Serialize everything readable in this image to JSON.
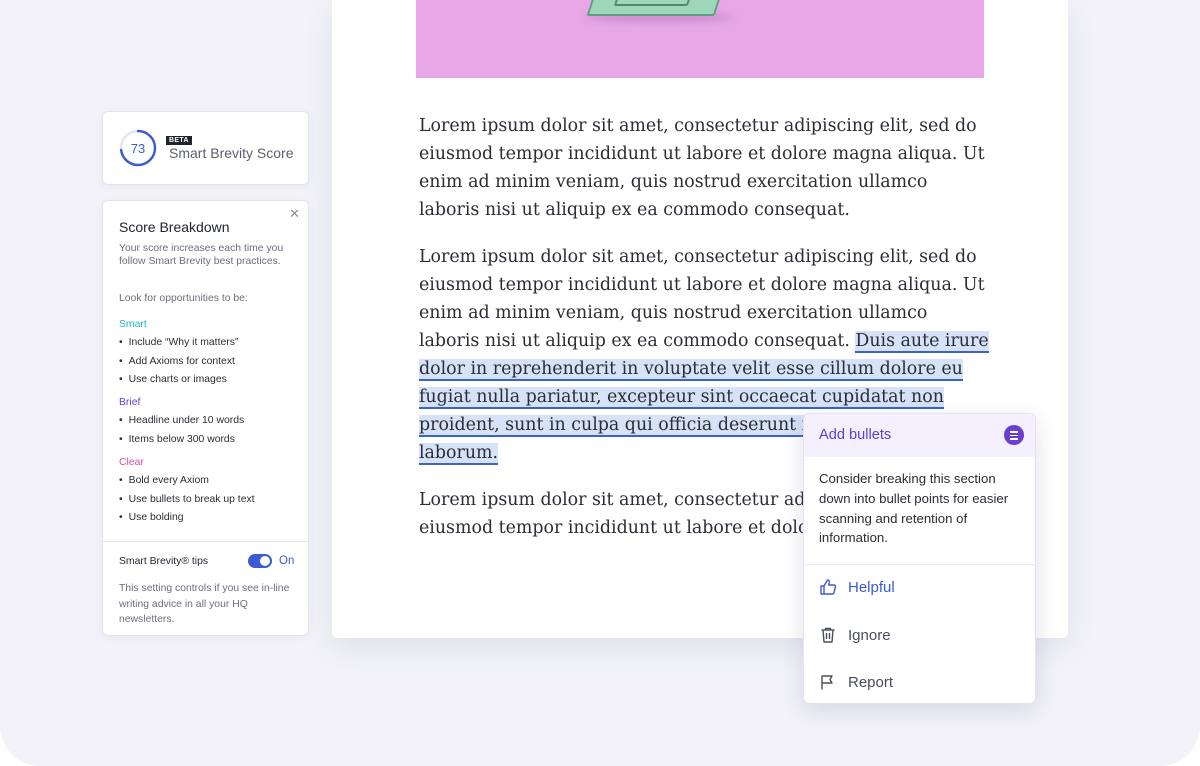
{
  "score_card": {
    "score": "73",
    "score_fraction": 0.73,
    "badge": "BETA",
    "title": "Smart Brevity Score"
  },
  "breakdown": {
    "title": "Score Breakdown",
    "description": "Your score increases each time you follow Smart Brevity best practices.",
    "look_for": "Look for opportunities to be:",
    "categories": [
      {
        "name": "Smart",
        "color": "#1bb7c6",
        "items": [
          "Include “Why it matters”",
          "Add Axioms for context",
          "Use charts or images"
        ]
      },
      {
        "name": "Brief",
        "color": "#6a3fd0",
        "items": [
          "Headline under 10 words",
          "Items below 300 words"
        ]
      },
      {
        "name": "Clear",
        "color": "#e04bb0",
        "items": [
          "Bold every Axiom",
          "Use bullets to break up text",
          "Use bolding"
        ]
      }
    ],
    "tips_label": "Smart Brevity® tips",
    "toggle_state": "On",
    "tips_description": "This setting controls if you see in-line writing advice in all your HQ newsletters."
  },
  "document": {
    "paragraphs": [
      "Lorem ipsum dolor sit amet, consectetur adipiscing elit, sed do eiusmod tempor incididunt ut labore et dolore magna aliqua. Ut enim ad minim veniam, quis nostrud exercitation ullamco laboris nisi ut aliquip ex ea commodo consequat.",
      "Lorem ipsum dolor sit amet, consectetur adipiscing elit, sed do eiusmod tempor incididunt ut labore et dolore magna aliqua. Ut enim ad minim veniam, quis nostrud exercitation ullamco laboris nisi ut aliquip ex ea commodo consequat.",
      "Lorem ipsum dolor sit amet, consectetur adipiscing elit, sed do eiusmod tempor incididunt ut labore et dolore magna"
    ],
    "highlighted": "Duis aute irure dolor in reprehenderit in voluptate velit esse cillum dolore eu fugiat nulla pariatur, excepteur sint occaecat cupidatat non proident, sunt in culpa qui officia deserunt mollit anim id est laborum."
  },
  "suggestion": {
    "title": "Add bullets",
    "icon": "list-icon",
    "body": "Consider breaking this section down into bullet points for easier scanning and retention of information.",
    "actions": [
      {
        "label": "Helpful",
        "icon": "thumbs-up-icon"
      },
      {
        "label": "Ignore",
        "icon": "trash-icon"
      },
      {
        "label": "Report",
        "icon": "flag-icon"
      }
    ]
  },
  "colors": {
    "accent_blue": "#3b5bd0",
    "accent_purple": "#6a3fd0",
    "highlight": "#d6e2f8",
    "hero": "#e8a8e8"
  }
}
